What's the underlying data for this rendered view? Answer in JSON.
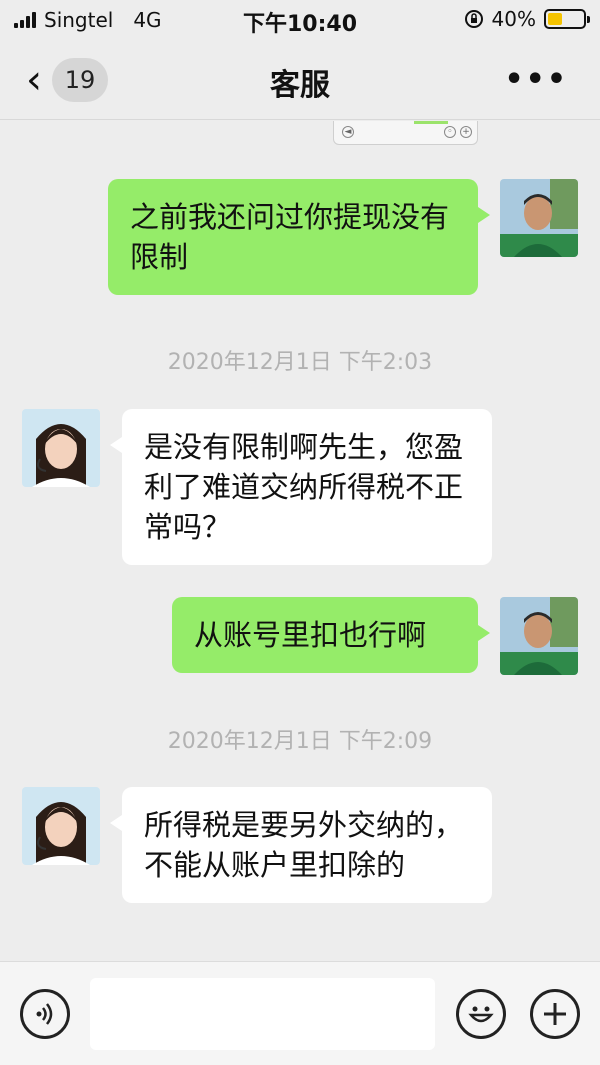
{
  "status_bar": {
    "carrier": "Singtel",
    "network": "4G",
    "time": "下午10:40",
    "battery": "40%"
  },
  "nav": {
    "back_count": "19",
    "title": "客服",
    "more": "•••"
  },
  "messages": [
    {
      "side": "me",
      "text": "之前我还问过你提现没有限制"
    },
    {
      "type": "timestamp",
      "text": "2020年12月1日 下午2:03"
    },
    {
      "side": "them",
      "text": "是没有限制啊先生，您盈利了难道交纳所得税不正常吗？"
    },
    {
      "side": "me",
      "text": "从账号里扣也行啊"
    },
    {
      "type": "timestamp",
      "text": "2020年12月1日 下午2:09"
    },
    {
      "side": "them",
      "text": "所得税是要另外交纳的，不能从账户里扣除的"
    }
  ],
  "input": {
    "placeholder": ""
  },
  "colors": {
    "me_bubble": "#95ec69",
    "them_bubble": "#ffffff",
    "background": "#ededed"
  },
  "icons": [
    "back-chevron-icon",
    "more-icon",
    "voice-icon",
    "emoji-icon",
    "plus-icon"
  ]
}
